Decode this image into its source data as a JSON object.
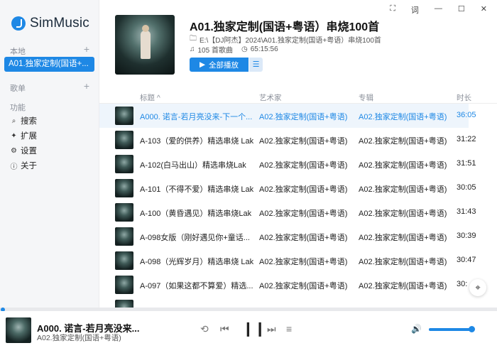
{
  "app": {
    "name": "SimMusic"
  },
  "window_controls": [
    "⛶",
    "词",
    "—",
    "☐",
    "✕"
  ],
  "sidebar": {
    "local_label": "本地",
    "playlist_label": "歌单",
    "functions_label": "功能",
    "active_item": "A01.独家定制(国语+...",
    "functions": [
      {
        "icon": "search-icon",
        "glyph": "⌕",
        "label": "搜索"
      },
      {
        "icon": "extension-icon",
        "glyph": "✦",
        "label": "扩展"
      },
      {
        "icon": "settings-icon",
        "glyph": "⚙",
        "label": "设置"
      },
      {
        "icon": "info-icon",
        "glyph": "ⓘ",
        "label": "关于"
      }
    ]
  },
  "playlist": {
    "title": "A01.独家定制(国语+粤语）串烧100首",
    "path": "E:\\【DJ阿杰】2024\\A01.独家定制(国语+粤语）串烧100首",
    "count": "105 首歌曲",
    "duration": "65:15:56",
    "play_all_label": "全部播放"
  },
  "table": {
    "headers": {
      "title": "标题 ^",
      "artist": "艺术家",
      "album": "专辑",
      "duration": "时长"
    },
    "rows": [
      {
        "title": "A000. 诺言-若月亮没来-下一个...",
        "artist": "A02.独家定制(国语+粤语)",
        "album": "A02.独家定制(国语+粤语)",
        "duration": "36:05",
        "active": true
      },
      {
        "title": "A-103（爱的供养）精选串烧 Lak",
        "artist": "A02.独家定制(国语+粤语)",
        "album": "A02.独家定制(国语+粤语)",
        "duration": "31:22"
      },
      {
        "title": "A-102(白马出山）精选串烧Lak",
        "artist": "A02.独家定制(国语+粤语)",
        "album": "A02.独家定制(国语+粤语)",
        "duration": "31:51"
      },
      {
        "title": "A-101（不得不爱）精选串烧 Lak",
        "artist": "A02.独家定制(国语+粤语)",
        "album": "A02.独家定制(国语+粤语)",
        "duration": "30:05"
      },
      {
        "title": "A-100（黄昏遇见）精选串烧Lak",
        "artist": "A02.独家定制(国语+粤语)",
        "album": "A02.独家定制(国语+粤语)",
        "duration": "31:43"
      },
      {
        "title": "A-098女版（刚好遇见你+童话...",
        "artist": "A02.独家定制(国语+粤语)",
        "album": "A02.独家定制(国语+粤语)",
        "duration": "30:39"
      },
      {
        "title": "A-098（光辉岁月）精选串烧 Lak",
        "artist": "A02.独家定制(国语+粤语)",
        "album": "A02.独家定制(国语+粤语)",
        "duration": "30:47"
      },
      {
        "title": "A-097（如果这都不算爱）精选...",
        "artist": "A02.独家定制(国语+粤语)",
        "album": "A02.独家定制(国语+粤语)",
        "duration": "30:"
      },
      {
        "title": "",
        "artist": "",
        "album": "",
        "duration": ""
      }
    ]
  },
  "player": {
    "title": "A000. 诺言-若月亮没来...",
    "album": "A02.独家定制(国语+粤语)",
    "progress": 0.003,
    "volume": 0.92
  },
  "colors": {
    "accent": "#1e88e5"
  }
}
